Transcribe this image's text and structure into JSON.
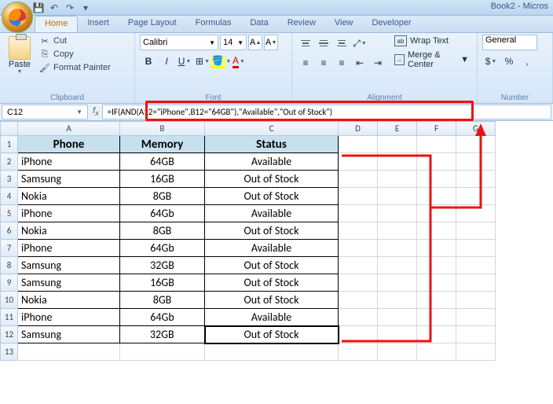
{
  "app": {
    "title": "Book2 - Micros"
  },
  "qat": [
    "save",
    "undo",
    "redo"
  ],
  "tabs": [
    "Home",
    "Insert",
    "Page Layout",
    "Formulas",
    "Data",
    "Review",
    "View",
    "Developer"
  ],
  "active_tab": "Home",
  "ribbon": {
    "clipboard": {
      "paste": "Paste",
      "cut": "Cut",
      "copy": "Copy",
      "format_painter": "Format Painter",
      "label": "Clipboard"
    },
    "font": {
      "name": "Calibri",
      "size": "14",
      "label": "Font"
    },
    "alignment": {
      "wrap": "Wrap Text",
      "merge": "Merge & Center",
      "label": "Alignment"
    },
    "number": {
      "format": "General",
      "label": "Number"
    }
  },
  "namebox": "C12",
  "formula": "=IF(AND(A12=\"iPhone\",B12=\"64GB\"),\"Available\",\"Out of Stock\")",
  "columns": [
    "A",
    "B",
    "C",
    "D",
    "E",
    "F",
    "G"
  ],
  "headers": {
    "a": "Phone",
    "b": "Memory",
    "c": "Status"
  },
  "rows": [
    {
      "a": "iPhone",
      "b": "64GB",
      "c": "Available"
    },
    {
      "a": "Samsung",
      "b": "16GB",
      "c": "Out of Stock"
    },
    {
      "a": "Nokia",
      "b": "8GB",
      "c": "Out of Stock"
    },
    {
      "a": "iPhone",
      "b": "64Gb",
      "c": "Available"
    },
    {
      "a": "Nokia",
      "b": "8GB",
      "c": "Out of Stock"
    },
    {
      "a": "iPhone",
      "b": "64Gb",
      "c": "Available"
    },
    {
      "a": "Samsung",
      "b": "32GB",
      "c": "Out of Stock"
    },
    {
      "a": "Samsung",
      "b": "16GB",
      "c": "Out of Stock"
    },
    {
      "a": "Nokia",
      "b": "8GB",
      "c": "Out of Stock"
    },
    {
      "a": "iPhone",
      "b": "64Gb",
      "c": "Available"
    },
    {
      "a": "Samsung",
      "b": "32GB",
      "c": "Out of Stock"
    }
  ],
  "selected_cell": "C12"
}
